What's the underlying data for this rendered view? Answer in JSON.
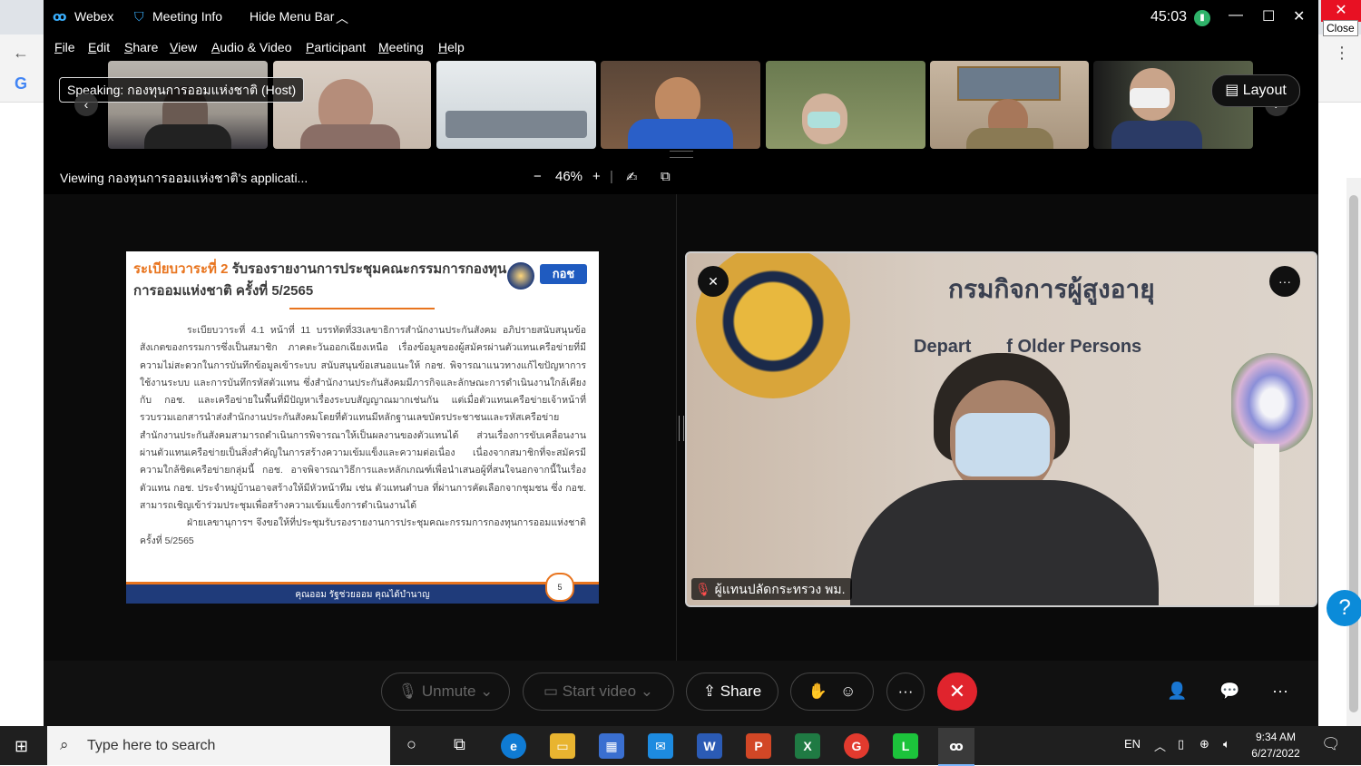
{
  "titlebar": {
    "app_name": "Webex",
    "meeting_info": "Meeting Info",
    "hide_menu_bar": "Hide Menu Bar",
    "timer": "45:03",
    "close_tooltip": "Close"
  },
  "menu": [
    "File",
    "Edit",
    "Share",
    "View",
    "Audio & Video",
    "Participant",
    "Meeting",
    "Help"
  ],
  "filmstrip": {
    "speaking_label": "Speaking: กองทุนการออมแห่งชาติ (Host)",
    "layout_label": "Layout"
  },
  "viewbar": {
    "viewing_label": "Viewing กองทุนการออมแห่งชาติ's applicati...",
    "zoom_minus": "−",
    "zoom_level": "46%",
    "zoom_plus": "+"
  },
  "slide": {
    "title_prefix": "ระเบียบวาระที่ 2",
    "title_rest": " รับรองรายงานการประชุมคณะกรรมการกองทุน",
    "title_line2": "การออมแห่งชาติ ครั้งที่ 5/2565",
    "logo_text": "กอช",
    "para1": "ระเบียบวาระที่ 4.1 หน้าที่ 11 บรรทัดที่33เลขาธิการสำนักงานประกันสังคม อภิปรายสนับสนุนข้อสังเกตของกรรมการซึ่งเป็นสมาชิก ภาคตะวันออกเฉียงเหนือ เรื่องข้อมูลของผู้สมัครผ่านตัวแทนเครือข่ายที่มีความไม่สะดวกในการบันทึกข้อมูลเข้าระบบ สนับสนุนข้อเสนอแนะให้ กอช. พิจารณาแนวทางแก้ไขปัญหาการใช้งานระบบ และการบันทึกรหัสตัวแทน ซึ่งสำนักงานประกันสังคมมีภารกิจและลักษณะการดำเนินงานใกล้เคียงกับ กอช. และเครือข่ายในพื้นที่มีปัญหาเรื่องระบบสัญญาณมากเช่นกัน แต่เมื่อตัวแทนเครือข่ายเจ้าหน้าที่รวบรวมเอกสารนำส่งสำนักงานประกันสังคมโดยที่ตัวแทนมีหลักฐานเลขบัตรประชาชนและรหัสเครือข่าย สำนักงานประกันสังคมสามารถดำเนินการพิจารณาให้เป็นผลงานของตัวแทนได้ ส่วนเรื่องการขับเคลื่อนงานผ่านตัวแทนเครือข่ายเป็นสิ่งสำคัญในการสร้างความเข้มแข็งและความต่อเนื่อง เนื่องจากสมาชิกที่จะสมัครมีความใกล้ชิดเครือข่ายกลุ่มนี้ กอช. อาจพิจารณาวิธีการและหลักเกณฑ์เพื่อนำเสนอผู้ที่สนใจนอกจากนี้ในเรื่องตัวแทน กอช. ประจำหมู่บ้านอาจสร้างให้มีหัวหน้าทีม เช่น ตัวแทนตำบล ที่ผ่านการคัดเลือกจากชุมชน ซึ่ง กอช. สามารถเชิญเข้าร่วมประชุมเพื่อสร้างความเข้มแข็งการดำเนินงานได้",
    "para2": "ฝ่ายเลขานุการฯ จึงขอให้ที่ประชุมรับรองรายงานการประชุมคณะกรรมการกองทุนการออมแห่งชาติ ครั้งที่ 5/2565",
    "footer": "คุณออม รัฐช่วยออม คุณได้บำนาญ",
    "page_number": "5"
  },
  "speaker": {
    "wall_text_th": "กรมกิจการผู้สูงอายุ",
    "wall_text_en": "Depart       f Older Persons",
    "name": "ผู้แทนปลัดกระทรวง พม."
  },
  "controls": {
    "unmute": "Unmute",
    "start_video": "Start video",
    "share": "Share",
    "more": "···"
  },
  "taskbar": {
    "search_placeholder": "Type here to search",
    "lang": "EN",
    "time": "9:34 AM",
    "date": "6/27/2022"
  },
  "colors": {
    "accent": "#e8741e",
    "slide_footer": "#1f3b7a",
    "end_call": "#e0242d"
  }
}
